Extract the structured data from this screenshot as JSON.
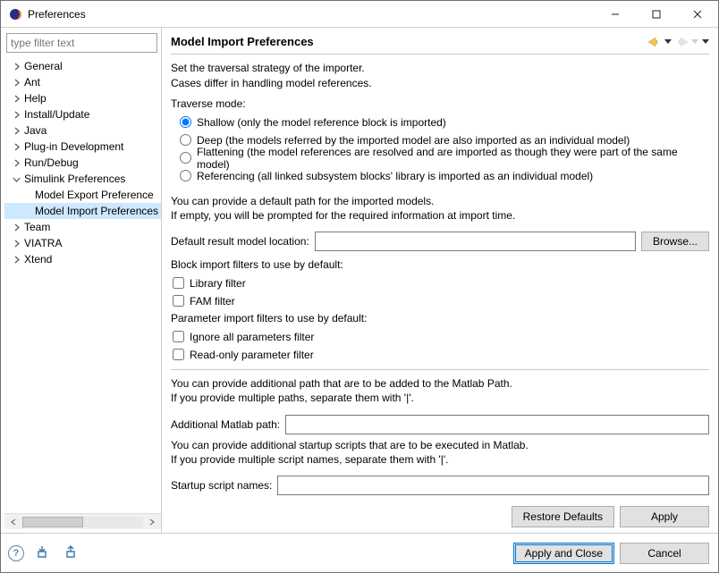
{
  "window": {
    "title": "Preferences"
  },
  "filter": {
    "placeholder": "type filter text"
  },
  "tree": {
    "items": [
      {
        "label": "General",
        "hasChildren": true,
        "expanded": false
      },
      {
        "label": "Ant",
        "hasChildren": true,
        "expanded": false
      },
      {
        "label": "Help",
        "hasChildren": true,
        "expanded": false
      },
      {
        "label": "Install/Update",
        "hasChildren": true,
        "expanded": false
      },
      {
        "label": "Java",
        "hasChildren": true,
        "expanded": false
      },
      {
        "label": "Plug-in Development",
        "hasChildren": true,
        "expanded": false
      },
      {
        "label": "Run/Debug",
        "hasChildren": true,
        "expanded": false
      },
      {
        "label": "Simulink Preferences",
        "hasChildren": true,
        "expanded": true,
        "children": [
          {
            "label": "Model Export Preference"
          },
          {
            "label": "Model Import Preferences",
            "selected": true
          }
        ]
      },
      {
        "label": "Team",
        "hasChildren": true,
        "expanded": false
      },
      {
        "label": "VIATRA",
        "hasChildren": true,
        "expanded": false
      },
      {
        "label": "Xtend",
        "hasChildren": true,
        "expanded": false
      }
    ]
  },
  "page": {
    "title": "Model Import Preferences",
    "intro1": "Set the traversal strategy of the importer.",
    "intro2": "Cases differ in handling model references.",
    "traverse": {
      "label": "Traverse mode:",
      "options": [
        {
          "value": "shallow",
          "label": "Shallow (only the model reference block is imported)",
          "checked": true
        },
        {
          "value": "deep",
          "label": "Deep (the models referred by the imported model are also imported as an individual model)",
          "checked": false
        },
        {
          "value": "flattening",
          "label": "Flattening (the model references are resolved and are imported as though they were part of the same model)",
          "checked": false
        },
        {
          "value": "referencing",
          "label": "Referencing (all linked subsystem blocks' library is imported as an individual model)",
          "checked": false
        }
      ]
    },
    "defaultPath": {
      "line1": "You can provide a default path for the imported models.",
      "line2": "If empty, you will be prompted for the required information at import time.",
      "fieldLabel": "Default result model location:",
      "value": "",
      "browse": "Browse..."
    },
    "blockFilters": {
      "label": "Block import filters to use by default:",
      "items": [
        {
          "label": "Library filter",
          "checked": false
        },
        {
          "label": "FAM filter",
          "checked": false
        }
      ]
    },
    "paramFilters": {
      "label": "Parameter import filters to use by default:",
      "items": [
        {
          "label": "Ignore all parameters filter",
          "checked": false
        },
        {
          "label": "Read-only parameter filter",
          "checked": false
        }
      ]
    },
    "matlabPath": {
      "line1": "You can provide additional path that are to be added to the Matlab Path.",
      "line2": "If you provide multiple paths, separate them with '|'.",
      "fieldLabel": "Additional Matlab path:",
      "value": ""
    },
    "startupScripts": {
      "line1": "You can provide additional startup scripts that are to be executed in Matlab.",
      "line2": "If you provide multiple script names, separate them with '|'.",
      "fieldLabel": "Startup script names:",
      "value": ""
    },
    "buttons": {
      "restoreDefaults": "Restore Defaults",
      "apply": "Apply",
      "applyAndClose": "Apply and Close",
      "cancel": "Cancel"
    }
  }
}
